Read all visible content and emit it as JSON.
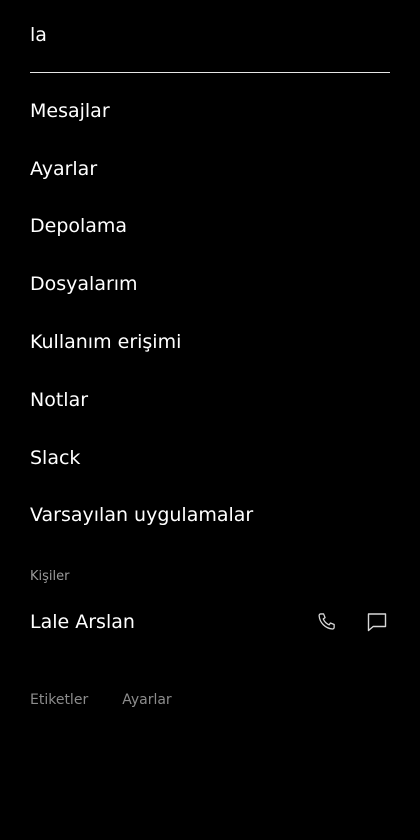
{
  "search": {
    "value": "la",
    "placeholder": ""
  },
  "results": [
    {
      "label": "Mesajlar"
    },
    {
      "label": "Ayarlar"
    },
    {
      "label": "Depolama"
    },
    {
      "label": "Dosyalarım"
    },
    {
      "label": "Kullanım erişimi"
    },
    {
      "label": "Notlar"
    },
    {
      "label": "Slack"
    },
    {
      "label": "Varsayılan uygulamalar"
    }
  ],
  "contacts": {
    "section_label": "Kişiler",
    "items": [
      {
        "name": "Lale Arslan",
        "call_icon": "phone-icon",
        "message_icon": "message-icon"
      }
    ]
  },
  "footer": {
    "links": [
      {
        "label": "Etiketler"
      },
      {
        "label": "Ayarlar"
      }
    ]
  },
  "colors": {
    "background": "#000000",
    "text": "#ffffff",
    "muted_text": "#9a9a9a",
    "underline": "#e6e6e6"
  }
}
